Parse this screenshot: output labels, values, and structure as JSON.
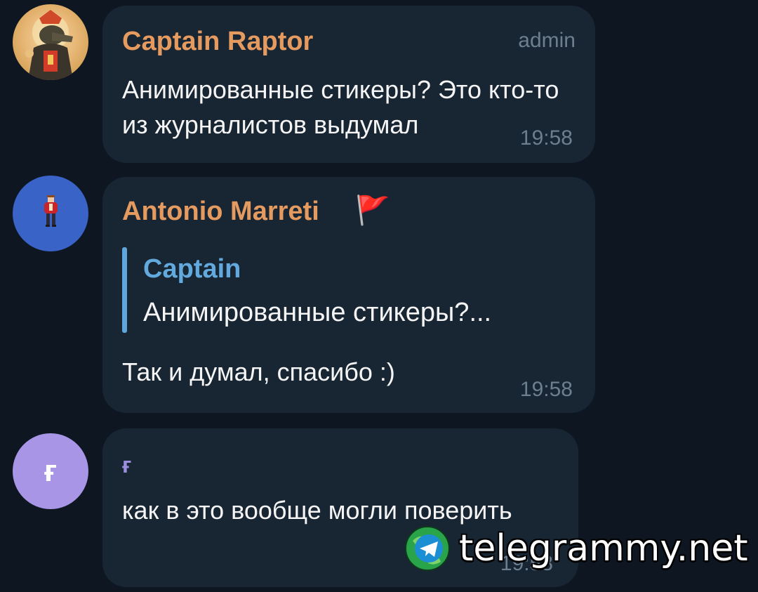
{
  "messages": [
    {
      "sender": "Captain Raptor",
      "role": "admin",
      "text": "Анимированные стикеры? Это кто-то из журналистов выдумал",
      "time": "19:58",
      "avatar_icon": "raptor-avatar-icon"
    },
    {
      "sender": "Antonio Marreti",
      "sender_emoji": "🚩",
      "reply": {
        "name": "Captain",
        "text": "Анимированные стикеры?..."
      },
      "text": "Так и думал, спасибо :)",
      "time": "19:58",
      "avatar_icon": "pixel-character-avatar-icon"
    },
    {
      "sender": "ғ",
      "avatar_letter": "ғ",
      "text": "как в это вообще могли поверить",
      "time": "19:58"
    }
  ],
  "watermark": {
    "text": "telegrammy.net",
    "icon": "telegram-globe-icon"
  },
  "colors": {
    "background": "#0e1621",
    "bubble": "#182533",
    "sender_orange": "#e59a5f",
    "sender_purple": "#9d8fe0",
    "reply_blue": "#62a9dd",
    "avatar_blue": "#3a63c7",
    "avatar_purple": "#a895e6"
  }
}
